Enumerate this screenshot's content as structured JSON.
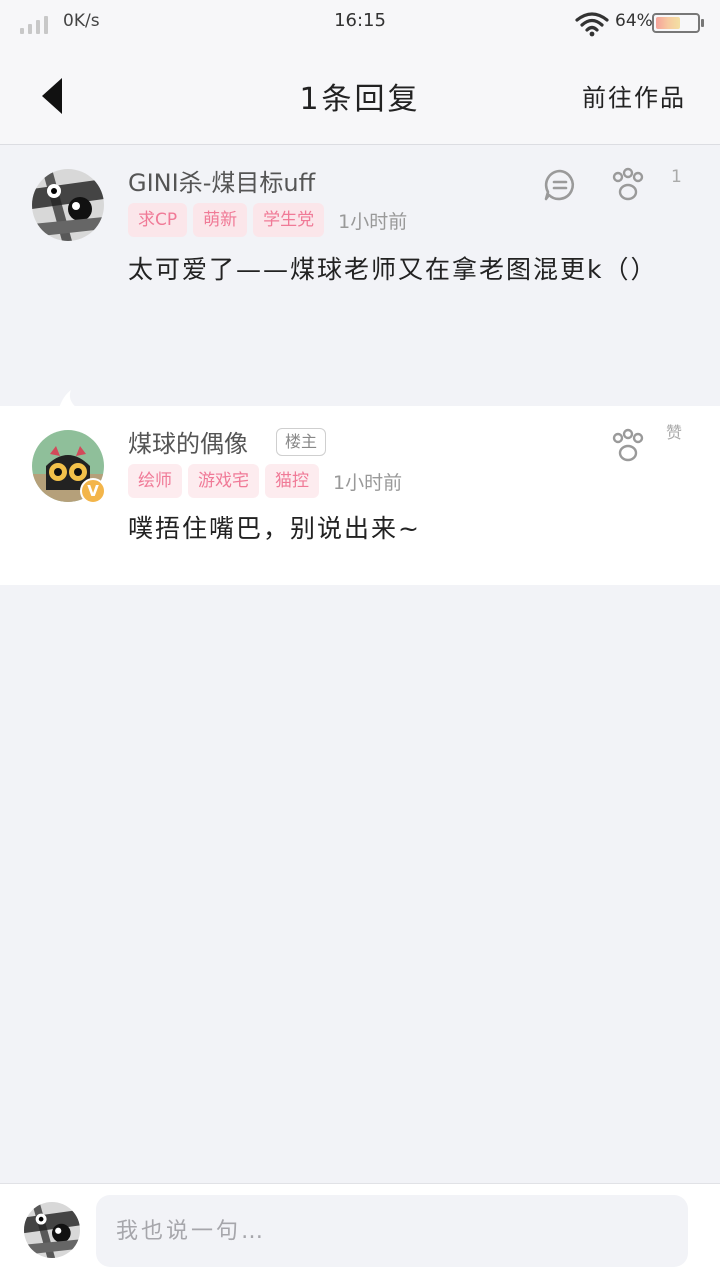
{
  "status_bar": {
    "net_speed": "0K/s",
    "time": "16:15",
    "battery_percent": "64%",
    "battery_level": 0.64
  },
  "header": {
    "title": "1条回复",
    "goto_label": "前往作品",
    "back_icon": "chevron-left-icon"
  },
  "comments": [
    {
      "username": "GINI杀-煤目标uff",
      "tags": [
        "求CP",
        "萌新",
        "学生党"
      ],
      "time": "1小时前",
      "content": "太可爱了——煤球老师又在拿老图混更k（）",
      "like_count": "1",
      "icons": [
        "reply-icon",
        "paw-like-icon"
      ]
    },
    {
      "username": "煤球的偶像",
      "badge": "楼主",
      "tags": [
        "绘师",
        "游戏宅",
        "猫控"
      ],
      "time": "1小时前",
      "content": "噗捂住嘴巴，别说出来~",
      "like_label": "赞",
      "verified": "V",
      "icons": [
        "paw-like-icon"
      ]
    }
  ],
  "input_bar": {
    "placeholder": "我也说一句…"
  },
  "colors": {
    "tag_text": "#f07a97",
    "tag_bg": "#fdecef",
    "page_bg": "#f2f3f7",
    "verified_badge": "#f3b54a"
  }
}
